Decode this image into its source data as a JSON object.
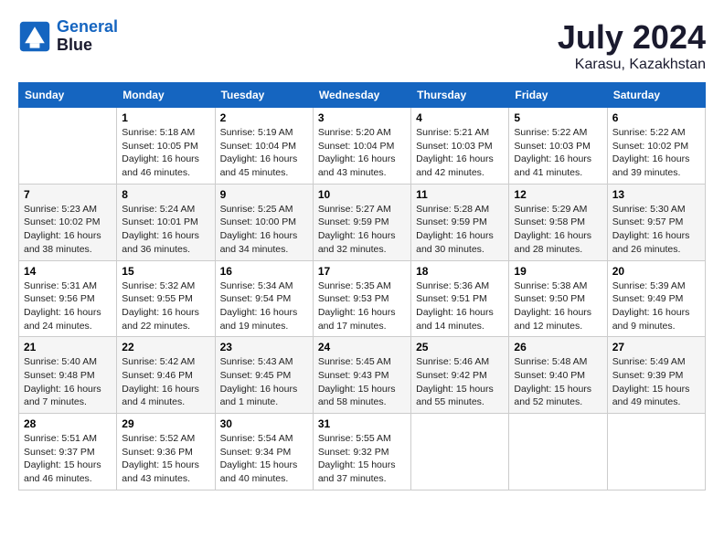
{
  "header": {
    "logo_line1": "General",
    "logo_line2": "Blue",
    "month_year": "July 2024",
    "location": "Karasu, Kazakhstan"
  },
  "columns": [
    "Sunday",
    "Monday",
    "Tuesday",
    "Wednesday",
    "Thursday",
    "Friday",
    "Saturday"
  ],
  "weeks": [
    [
      {
        "day": "",
        "info": ""
      },
      {
        "day": "1",
        "info": "Sunrise: 5:18 AM\nSunset: 10:05 PM\nDaylight: 16 hours\nand 46 minutes."
      },
      {
        "day": "2",
        "info": "Sunrise: 5:19 AM\nSunset: 10:04 PM\nDaylight: 16 hours\nand 45 minutes."
      },
      {
        "day": "3",
        "info": "Sunrise: 5:20 AM\nSunset: 10:04 PM\nDaylight: 16 hours\nand 43 minutes."
      },
      {
        "day": "4",
        "info": "Sunrise: 5:21 AM\nSunset: 10:03 PM\nDaylight: 16 hours\nand 42 minutes."
      },
      {
        "day": "5",
        "info": "Sunrise: 5:22 AM\nSunset: 10:03 PM\nDaylight: 16 hours\nand 41 minutes."
      },
      {
        "day": "6",
        "info": "Sunrise: 5:22 AM\nSunset: 10:02 PM\nDaylight: 16 hours\nand 39 minutes."
      }
    ],
    [
      {
        "day": "7",
        "info": "Sunrise: 5:23 AM\nSunset: 10:02 PM\nDaylight: 16 hours\nand 38 minutes."
      },
      {
        "day": "8",
        "info": "Sunrise: 5:24 AM\nSunset: 10:01 PM\nDaylight: 16 hours\nand 36 minutes."
      },
      {
        "day": "9",
        "info": "Sunrise: 5:25 AM\nSunset: 10:00 PM\nDaylight: 16 hours\nand 34 minutes."
      },
      {
        "day": "10",
        "info": "Sunrise: 5:27 AM\nSunset: 9:59 PM\nDaylight: 16 hours\nand 32 minutes."
      },
      {
        "day": "11",
        "info": "Sunrise: 5:28 AM\nSunset: 9:59 PM\nDaylight: 16 hours\nand 30 minutes."
      },
      {
        "day": "12",
        "info": "Sunrise: 5:29 AM\nSunset: 9:58 PM\nDaylight: 16 hours\nand 28 minutes."
      },
      {
        "day": "13",
        "info": "Sunrise: 5:30 AM\nSunset: 9:57 PM\nDaylight: 16 hours\nand 26 minutes."
      }
    ],
    [
      {
        "day": "14",
        "info": "Sunrise: 5:31 AM\nSunset: 9:56 PM\nDaylight: 16 hours\nand 24 minutes."
      },
      {
        "day": "15",
        "info": "Sunrise: 5:32 AM\nSunset: 9:55 PM\nDaylight: 16 hours\nand 22 minutes."
      },
      {
        "day": "16",
        "info": "Sunrise: 5:34 AM\nSunset: 9:54 PM\nDaylight: 16 hours\nand 19 minutes."
      },
      {
        "day": "17",
        "info": "Sunrise: 5:35 AM\nSunset: 9:53 PM\nDaylight: 16 hours\nand 17 minutes."
      },
      {
        "day": "18",
        "info": "Sunrise: 5:36 AM\nSunset: 9:51 PM\nDaylight: 16 hours\nand 14 minutes."
      },
      {
        "day": "19",
        "info": "Sunrise: 5:38 AM\nSunset: 9:50 PM\nDaylight: 16 hours\nand 12 minutes."
      },
      {
        "day": "20",
        "info": "Sunrise: 5:39 AM\nSunset: 9:49 PM\nDaylight: 16 hours\nand 9 minutes."
      }
    ],
    [
      {
        "day": "21",
        "info": "Sunrise: 5:40 AM\nSunset: 9:48 PM\nDaylight: 16 hours\nand 7 minutes."
      },
      {
        "day": "22",
        "info": "Sunrise: 5:42 AM\nSunset: 9:46 PM\nDaylight: 16 hours\nand 4 minutes."
      },
      {
        "day": "23",
        "info": "Sunrise: 5:43 AM\nSunset: 9:45 PM\nDaylight: 16 hours\nand 1 minute."
      },
      {
        "day": "24",
        "info": "Sunrise: 5:45 AM\nSunset: 9:43 PM\nDaylight: 15 hours\nand 58 minutes."
      },
      {
        "day": "25",
        "info": "Sunrise: 5:46 AM\nSunset: 9:42 PM\nDaylight: 15 hours\nand 55 minutes."
      },
      {
        "day": "26",
        "info": "Sunrise: 5:48 AM\nSunset: 9:40 PM\nDaylight: 15 hours\nand 52 minutes."
      },
      {
        "day": "27",
        "info": "Sunrise: 5:49 AM\nSunset: 9:39 PM\nDaylight: 15 hours\nand 49 minutes."
      }
    ],
    [
      {
        "day": "28",
        "info": "Sunrise: 5:51 AM\nSunset: 9:37 PM\nDaylight: 15 hours\nand 46 minutes."
      },
      {
        "day": "29",
        "info": "Sunrise: 5:52 AM\nSunset: 9:36 PM\nDaylight: 15 hours\nand 43 minutes."
      },
      {
        "day": "30",
        "info": "Sunrise: 5:54 AM\nSunset: 9:34 PM\nDaylight: 15 hours\nand 40 minutes."
      },
      {
        "day": "31",
        "info": "Sunrise: 5:55 AM\nSunset: 9:32 PM\nDaylight: 15 hours\nand 37 minutes."
      },
      {
        "day": "",
        "info": ""
      },
      {
        "day": "",
        "info": ""
      },
      {
        "day": "",
        "info": ""
      }
    ]
  ]
}
